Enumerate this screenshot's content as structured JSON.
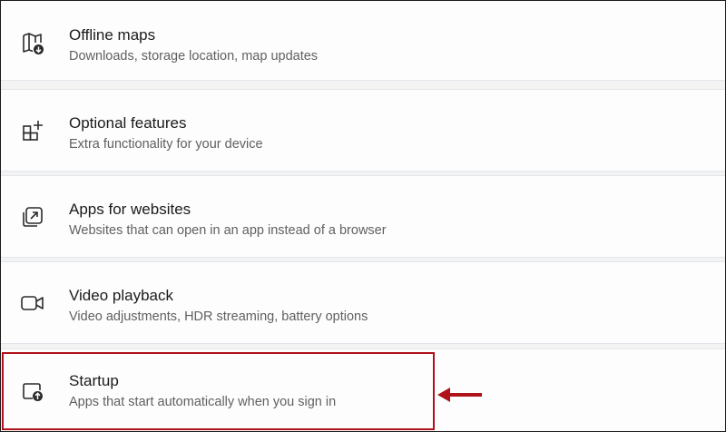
{
  "settings_list": {
    "items": [
      {
        "icon": "offline-map-icon",
        "title": "Offline maps",
        "description": "Downloads, storage location, map updates"
      },
      {
        "icon": "optional-features-icon",
        "title": "Optional features",
        "description": "Extra functionality for your device"
      },
      {
        "icon": "open-in-app-icon",
        "title": "Apps for websites",
        "description": "Websites that can open in an app instead of a browser"
      },
      {
        "icon": "video-camera-icon",
        "title": "Video playback",
        "description": "Video adjustments, HDR streaming, battery options"
      },
      {
        "icon": "startup-app-icon",
        "title": "Startup",
        "description": "Apps that start automatically when you sign in"
      }
    ]
  },
  "colors": {
    "highlight_border": "#b0121b",
    "arrow": "#b0121b"
  }
}
